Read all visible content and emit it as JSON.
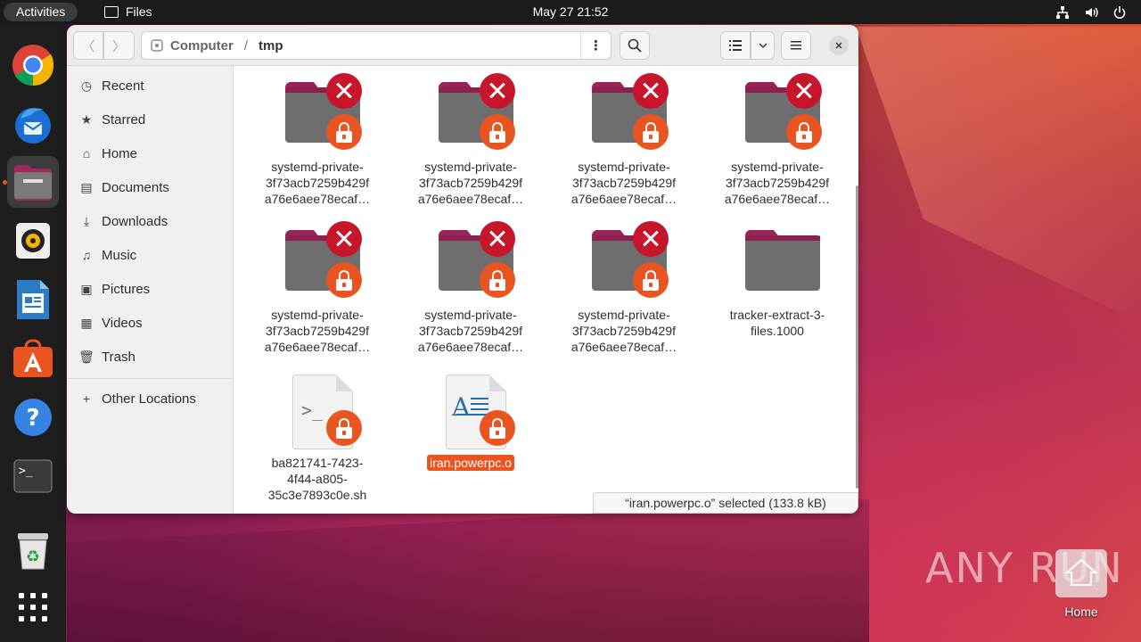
{
  "topbar": {
    "activities": "Activities",
    "app_name": "Files",
    "clock": "May 27  21:52"
  },
  "headerbar": {
    "path": [
      "Computer",
      "/",
      "tmp"
    ]
  },
  "sidebar": {
    "items": [
      {
        "label": "Recent",
        "icon": "clock-icon"
      },
      {
        "label": "Starred",
        "icon": "star-icon"
      },
      {
        "label": "Home",
        "icon": "home-icon"
      },
      {
        "label": "Documents",
        "icon": "document-icon"
      },
      {
        "label": "Downloads",
        "icon": "download-icon"
      },
      {
        "label": "Music",
        "icon": "music-icon"
      },
      {
        "label": "Pictures",
        "icon": "picture-icon"
      },
      {
        "label": "Videos",
        "icon": "video-icon"
      },
      {
        "label": "Trash",
        "icon": "trash-icon"
      }
    ],
    "other_locations": "Other Locations"
  },
  "files": [
    {
      "name": [
        "systemd-private-",
        "3f73acb7259b429f",
        "a76e6aee78ecaf…"
      ],
      "type": "folder-locked"
    },
    {
      "name": [
        "systemd-private-",
        "3f73acb7259b429f",
        "a76e6aee78ecaf…"
      ],
      "type": "folder-locked"
    },
    {
      "name": [
        "systemd-private-",
        "3f73acb7259b429f",
        "a76e6aee78ecaf…"
      ],
      "type": "folder-locked"
    },
    {
      "name": [
        "systemd-private-",
        "3f73acb7259b429f",
        "a76e6aee78ecaf…"
      ],
      "type": "folder-locked"
    },
    {
      "name": [
        "systemd-private-",
        "3f73acb7259b429f",
        "a76e6aee78ecaf…"
      ],
      "type": "folder-locked"
    },
    {
      "name": [
        "systemd-private-",
        "3f73acb7259b429f",
        "a76e6aee78ecaf…"
      ],
      "type": "folder-locked"
    },
    {
      "name": [
        "systemd-private-",
        "3f73acb7259b429f",
        "a76e6aee78ecaf…"
      ],
      "type": "folder-locked"
    },
    {
      "name": [
        "tracker-extract-3-",
        "files.1000"
      ],
      "type": "folder"
    },
    {
      "name": [
        "ba821741-7423-",
        "4f44-a805-",
        "35c3e7893c0e.sh"
      ],
      "type": "script-locked"
    },
    {
      "name": [
        "iran.powerpc.o"
      ],
      "type": "document-locked",
      "selected": true
    }
  ],
  "status": "“iran.powerpc.o” selected  (133.8 kB)",
  "desktop": {
    "watermark": "ANY RUN",
    "home_label": "Home"
  },
  "colors": {
    "accent": "#e95420",
    "error": "#c7162b",
    "folder_tab": "#9b2456"
  }
}
